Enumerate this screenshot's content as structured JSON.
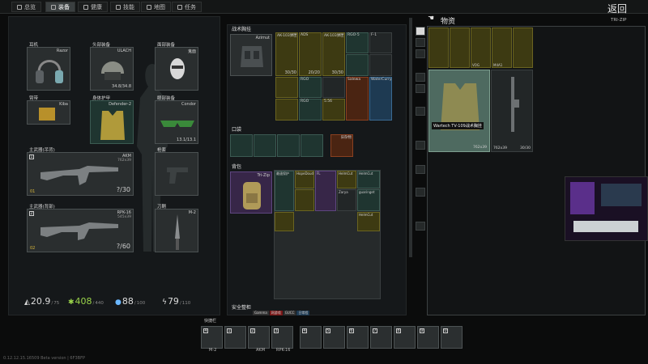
{
  "tabs": [
    {
      "label": "总览"
    },
    {
      "label": "装备"
    },
    {
      "label": "健康"
    },
    {
      "label": "技能"
    },
    {
      "label": "地图"
    },
    {
      "label": "任务"
    }
  ],
  "back_label": "返回",
  "tri_zip_label": "TRI-ZIP",
  "loot_title": "物资",
  "slots": {
    "earpiece": {
      "label": "耳机",
      "item": "Razor"
    },
    "headwear": {
      "label": "头部装备",
      "item": "ULACH",
      "durability": "34.8/34.8"
    },
    "facecover": {
      "label": "面部装备",
      "item": "鬼面"
    },
    "armband": {
      "label": "臂带",
      "item": "Kiba"
    },
    "body_armor": {
      "label": "身体护甲",
      "item": "Defender-2"
    },
    "eyewear": {
      "label": "眼部装备",
      "item": "Condor",
      "durability": "13.1/13.1"
    },
    "primary1": {
      "label": "主武器(吊背)",
      "item": "AKM",
      "detail": "762x39",
      "ammo": "?/30",
      "level": "01"
    },
    "holster": {
      "label": "枪套"
    },
    "primary2": {
      "label": "主武器(背部)",
      "item": "RPK-16",
      "detail": "545x39",
      "ammo": "?/60",
      "level": "02"
    },
    "melee": {
      "label": "刀鞘",
      "item": "M-2"
    }
  },
  "rig": {
    "label": "战术胸挂",
    "item": "Azimut",
    "mags": [
      {
        "name": "AK-103弹匣",
        "count": "30/30"
      },
      {
        "name": "ADS",
        "count": "20/20"
      },
      {
        "name": "AK-103弹匣",
        "count": "30/30"
      }
    ],
    "small": [
      "RGO-5",
      "F-1",
      "RGO",
      "RGO",
      "Salewa",
      "WaterCurry",
      "5.56"
    ]
  },
  "pockets": {
    "label": "口袋",
    "last": "旧杂物"
  },
  "backpack": {
    "label": "背包",
    "item": "Tri-Zip",
    "items": [
      "最速保护",
      "HopeDoud",
      "FL",
      "HelmCut",
      "Zarya",
      "HelmCut",
      "guaringet",
      "HelmCut"
    ]
  },
  "secure": {
    "label": "安全整柜",
    "tags": [
      "Gamma",
      "网游戏",
      "GUCC",
      "日常程"
    ]
  },
  "stats": [
    {
      "value": "20.9",
      "max": "75",
      "icon": "weight"
    },
    {
      "value": "408",
      "max": "440",
      "icon": "health"
    },
    {
      "value": "88",
      "max": "100",
      "icon": "hydration"
    },
    {
      "value": "79",
      "max": "110",
      "icon": "energy"
    }
  ],
  "loot_items": [
    "VOG",
    "M4A1",
    "Wartech TV-109战术胸挂",
    "762x39",
    "762x39"
  ],
  "wartech_label": "Wartech TV-109战术胸挂",
  "wartech_detail": "762x39",
  "wartech_count": "30/30",
  "quickbar": {
    "label": "快捷栏",
    "slots": [
      {
        "num": "4",
        "label": "M-2"
      },
      {
        "num": "1",
        "label": ""
      },
      {
        "num": "2",
        "label": "AKM"
      },
      {
        "num": "3",
        "label": "RPK-16"
      },
      {
        "num": "4",
        "label": ""
      },
      {
        "num": "5",
        "label": ""
      },
      {
        "num": "6",
        "label": ""
      },
      {
        "num": "7",
        "label": ""
      },
      {
        "num": "8",
        "label": ""
      },
      {
        "num": "9",
        "label": ""
      },
      {
        "num": "0",
        "label": ""
      }
    ]
  },
  "version": "0.12.12.15.16509 Beta version | 6F3BFP",
  "colors": {
    "accent": "#6a6420",
    "panel": "#15181a",
    "highlight": "#1f3530"
  }
}
